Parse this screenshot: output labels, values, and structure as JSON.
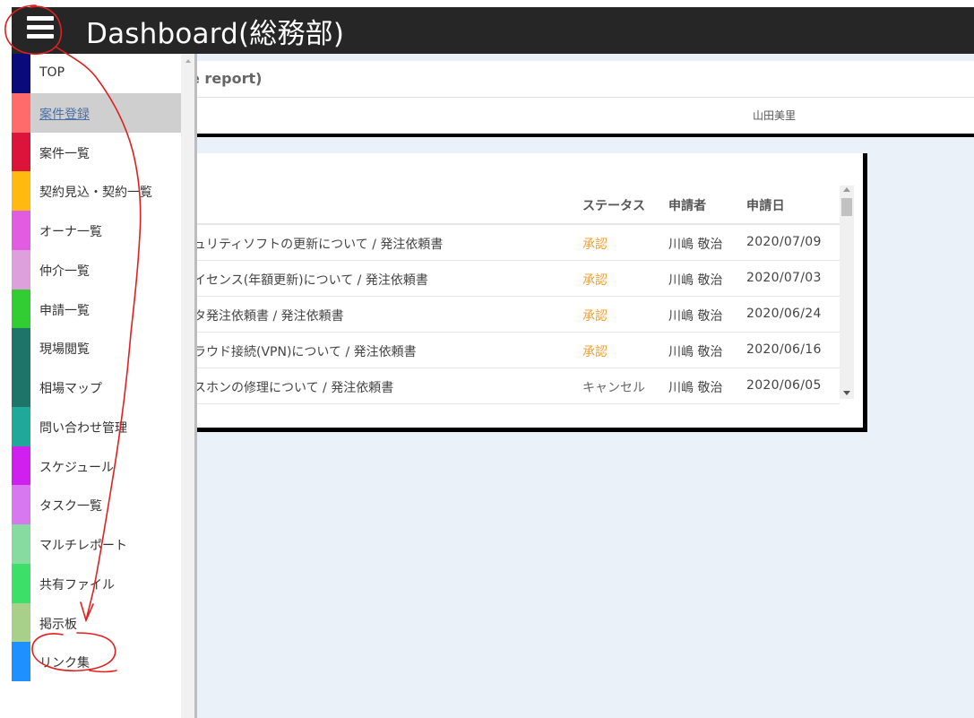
{
  "header": {
    "title": "Dashboard(総務部)"
  },
  "subbar": {
    "title_fragment": "e report)"
  },
  "user": {
    "name": "山田美里"
  },
  "table": {
    "headers": {
      "status": "ステータス",
      "applicant": "申請者",
      "date": "申請日"
    },
    "rows": [
      {
        "title": "ュリティソフトの更新について / 発注依頼書",
        "status": "承認",
        "applicant": "川嶋 敬治",
        "date": "2020/07/09"
      },
      {
        "title": "イセンス(年額更新)について / 発注依頼書",
        "status": "承認",
        "applicant": "川嶋 敬治",
        "date": "2020/07/03"
      },
      {
        "title": "タ発注依頼書 / 発注依頼書",
        "status": "承認",
        "applicant": "川嶋 敬治",
        "date": "2020/06/24"
      },
      {
        "title": "ラウド接続(VPN)について / 発注依頼書",
        "status": "承認",
        "applicant": "川嶋 敬治",
        "date": "2020/06/16"
      },
      {
        "title": "スホンの修理について / 発注依頼書",
        "status": "キャンセル",
        "applicant": "川嶋 敬治",
        "date": "2020/06/05"
      }
    ]
  },
  "colors": {
    "approved": "#f0a030",
    "cancelled": "#666666",
    "annotation": "#e02020"
  },
  "sidebar": {
    "items": [
      {
        "label": "TOP",
        "color": "#0a0a7a"
      },
      {
        "label": "案件登録",
        "color": "#ff6b6b",
        "active": true
      },
      {
        "label": "案件一覧",
        "color": "#dc143c"
      },
      {
        "label": "契約見込・契約一覧",
        "color": "#ffb90f"
      },
      {
        "label": "オーナ一覧",
        "color": "#e05ce0"
      },
      {
        "label": "仲介一覧",
        "color": "#dda0dd"
      },
      {
        "label": "申請一覧",
        "color": "#32cd32"
      },
      {
        "label": "現場閲覧",
        "color": "#1e7468"
      },
      {
        "label": "相場マップ",
        "color": "#1e7468"
      },
      {
        "label": "問い合わせ管理",
        "color": "#20a89a"
      },
      {
        "label": "スケジュール",
        "color": "#d020f0"
      },
      {
        "label": "タスク一覧",
        "color": "#d878f0"
      },
      {
        "label": "マルチレポート",
        "color": "#88dba0"
      },
      {
        "label": "共有ファイル",
        "color": "#3ce068"
      },
      {
        "label": "掲示板",
        "color": "#a8d08a"
      },
      {
        "label": "リンク集",
        "color": "#1e90ff"
      }
    ]
  }
}
